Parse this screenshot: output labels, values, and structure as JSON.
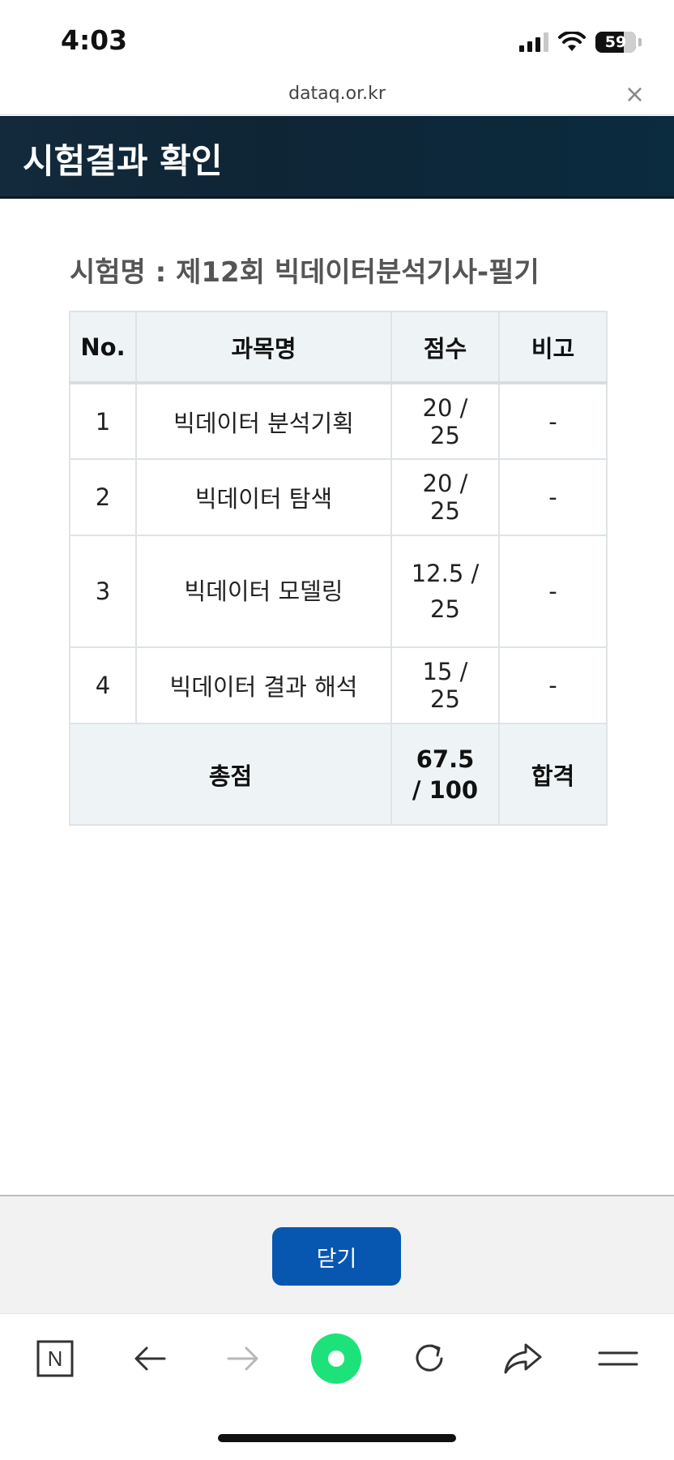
{
  "status_bar": {
    "time": "4:03",
    "battery": "59"
  },
  "browser": {
    "url": "dataq.or.kr",
    "close_symbol": "×"
  },
  "header": {
    "title": "시험결과 확인"
  },
  "exam": {
    "name": "시험명 : 제12회 빅데이터분석기사-필기"
  },
  "table": {
    "headers": [
      "No.",
      "과목명",
      "점수",
      "비고"
    ],
    "rows": [
      {
        "no": "1",
        "subject": "빅데이터 분석기획",
        "score": "20 / 25",
        "note": "-"
      },
      {
        "no": "2",
        "subject": "빅데이터 탐색",
        "score": "20 / 25",
        "note": "-"
      },
      {
        "no": "3",
        "subject": "빅데이터 모델링",
        "score": "12.5 / 25",
        "note": "-"
      },
      {
        "no": "4",
        "subject": "빅데이터 결과 해석",
        "score": "15 / 25",
        "note": "-"
      }
    ],
    "total": {
      "label": "총점",
      "score": "67.5 / 100",
      "result": "합격"
    }
  },
  "actions": {
    "close_label": "닫기"
  },
  "toolbar": {
    "home_letter": "N"
  },
  "colors": {
    "header_bg": "#0e2536",
    "table_header_bg": "#eef4f5",
    "close_button": "#0757b0",
    "green_button": "#1de27a"
  }
}
